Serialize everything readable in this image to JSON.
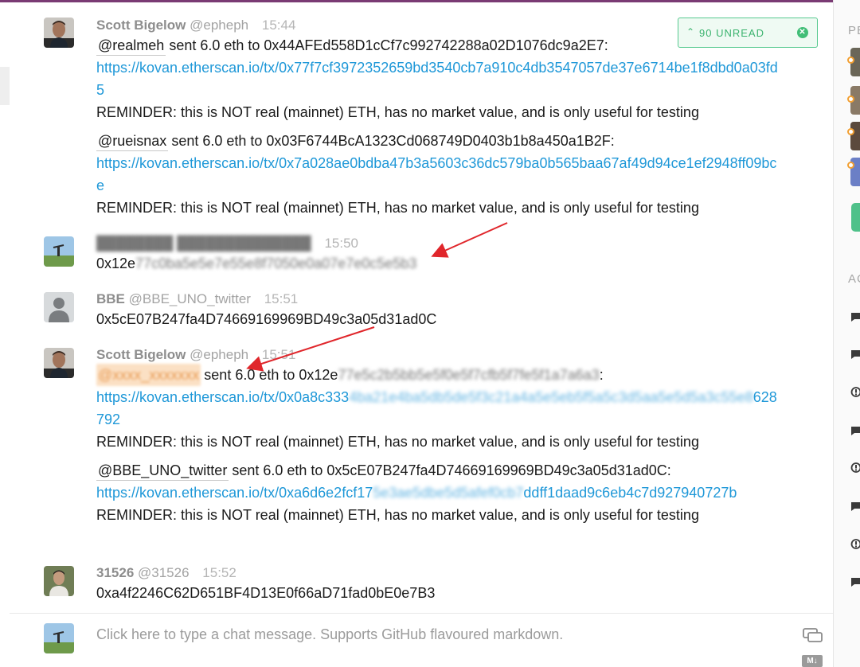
{
  "unread": {
    "label": "90 UNREAD"
  },
  "messages": [
    {
      "name": "Scott Bigelow",
      "user": "@epheph",
      "time": "15:44",
      "blocks": [
        {
          "mention": "@realmeh",
          "text": "sent 6.0 eth to 0x44AFEd558D1cCf7c992742288a02D1076dc9a2E7:",
          "link": "https://kovan.etherscan.io/tx/0x77f7cf3972352659bd3540cb7a910c4db3547057de37e6714be1f8dbd0a03fd5",
          "reminder": "REMINDER: this is NOT real (mainnet) ETH, has no market value, and is only useful for testing"
        },
        {
          "mention": "@rueisnax",
          "text": "sent 6.0 eth to 0x03F6744BcA1323Cd068749D0403b1b8a450a1B2F:",
          "link": "https://kovan.etherscan.io/tx/0x7a028ae0bdba47b3a5603c36dc579ba0b565baa67af49d94ce1ef2948ff09bce",
          "reminder": "REMINDER: this is NOT real (mainnet) ETH, has no market value, and is only useful for testing"
        }
      ]
    },
    {
      "time": "15:50",
      "text": "0x12e"
    },
    {
      "name": "BBE",
      "user": "@BBE_UNO_twitter",
      "time": "15:51",
      "text": "0x5cE07B247fa4D74669169969BD49c3a05d31ad0C"
    },
    {
      "name": "Scott Bigelow",
      "user": "@epheph",
      "time": "15:51",
      "blocks": [
        {
          "text": "sent 6.0 eth to 0x12e",
          "link_start": "https://kovan.etherscan.io/tx/0x0a8c333",
          "link_end": "628792",
          "reminder": "REMINDER: this is NOT real (mainnet) ETH, has no market value, and is only useful for testing"
        },
        {
          "mention": "@BBE_UNO_twitter",
          "text": "sent 6.0 eth to 0x5cE07B247fa4D74669169969BD49c3a05d31ad0C:",
          "link_start": "https://kovan.etherscan.io/tx/0xa6d6e2fcf17",
          "link_mid": "ddff1daad9c6eb4c7d927940",
          "link_end": "727b",
          "reminder": "REMINDER: this is NOT real (mainnet) ETH, has no market value, and is only useful for testing"
        }
      ]
    },
    {
      "name": "31526",
      "user": "@31526",
      "time": "15:52",
      "text": "0xa4f2246C62D651BF4D13E0f66aD71fad0bE0e7B3"
    }
  ],
  "composer": {
    "placeholder": "Click here to type a chat message. Supports GitHub flavoured markdown.",
    "md_badge": "M↓"
  },
  "right_panel": {
    "people_label": "PE",
    "activity_label": "AC"
  },
  "colors": {
    "accent": "#7a3b74",
    "link": "#1f98d8",
    "unread_green": "#41be77",
    "arrow": "#e0262b"
  }
}
